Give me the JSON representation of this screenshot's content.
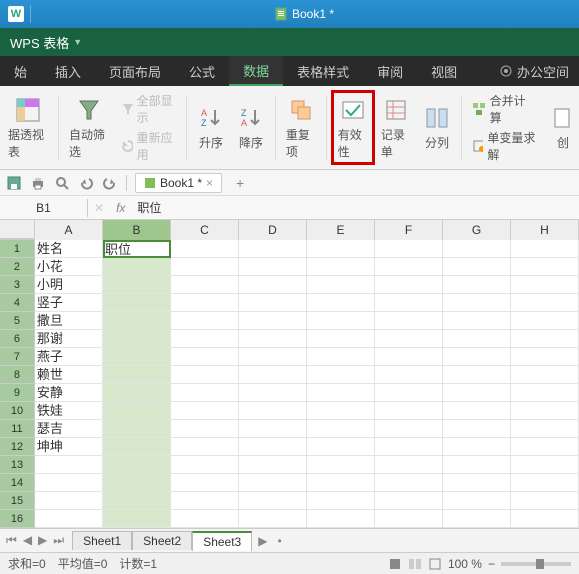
{
  "titlebar": {
    "app_hint": "W",
    "doc_title": "Book1 *"
  },
  "app_tab": {
    "name": "WPS 表格"
  },
  "menu": {
    "items": [
      "始",
      "插入",
      "页面布局",
      "公式",
      "数据",
      "表格样式",
      "审阅",
      "视图"
    ],
    "active_index": 4,
    "service": "办公空间"
  },
  "ribbon": {
    "pivot": "据透视表",
    "autofilter": "自动筛选",
    "showall": "全部显示",
    "reapply": "重新应用",
    "sortasc": "升序",
    "sortdesc": "降序",
    "duplicates": "重复项",
    "validity": "有效性",
    "recordform": "记录单",
    "texttocol": "分列",
    "consolidate": "合并计算",
    "solver": "单变量求解",
    "create": "创"
  },
  "qat": {
    "doc_tab": "Book1 *",
    "plus": "+"
  },
  "formula_bar": {
    "cell_ref": "B1",
    "fx": "fx",
    "value": "职位"
  },
  "grid": {
    "col_headers": [
      "A",
      "B",
      "C",
      "D",
      "E",
      "F",
      "G",
      "H"
    ],
    "selected_col": 1,
    "active_cell": "B1",
    "rowsA": [
      "姓名",
      "小花",
      "小明",
      "竖子",
      "撒旦",
      "那谢",
      "燕子",
      "赖世",
      "安静",
      "铁娃",
      "瑟吉",
      "坤坤",
      "",
      "",
      "",
      ""
    ],
    "rowB1": "职位"
  },
  "sheets": {
    "tabs": [
      "Sheet1",
      "Sheet2",
      "Sheet3"
    ],
    "active_index": 2
  },
  "status": {
    "sum": "求和=0",
    "avg": "平均值=0",
    "count": "计数=1",
    "zoom": "100 %"
  }
}
